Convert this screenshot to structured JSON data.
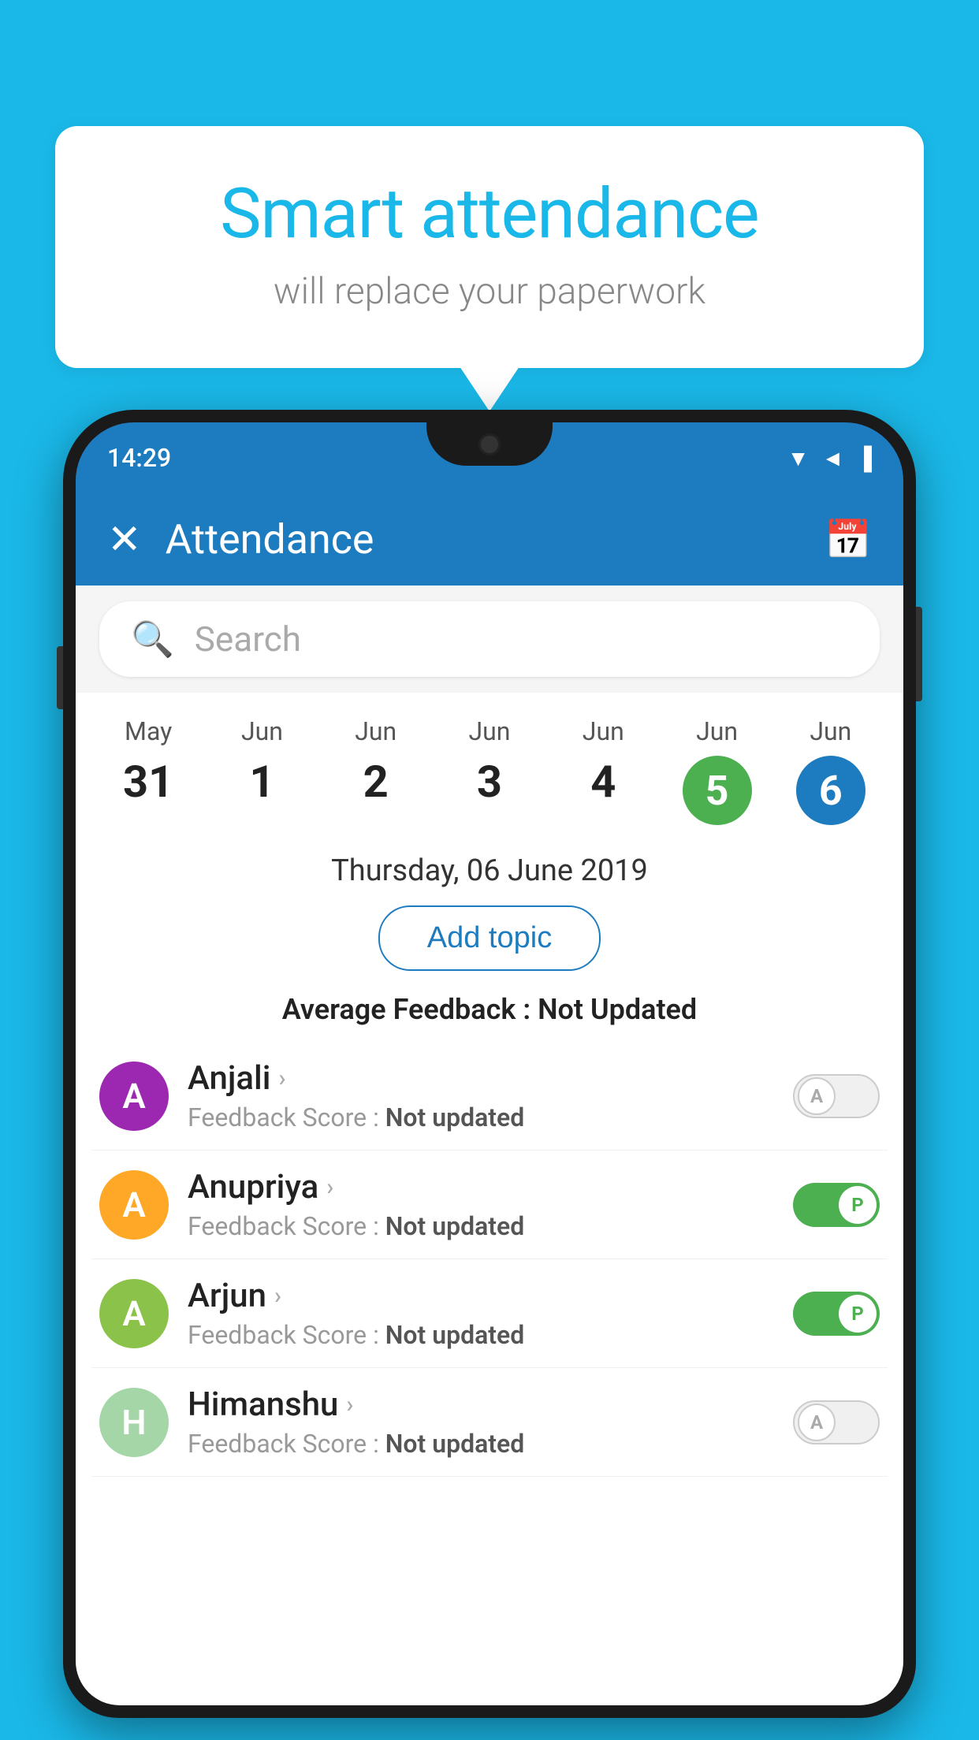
{
  "background_color": "#1ab8e8",
  "speech_bubble": {
    "title": "Smart attendance",
    "subtitle": "will replace your paperwork"
  },
  "status_bar": {
    "time": "14:29",
    "icons": "▼◄▐"
  },
  "app_header": {
    "title": "Attendance",
    "close_label": "✕",
    "calendar_icon": "📅"
  },
  "search": {
    "placeholder": "Search"
  },
  "calendar": {
    "days": [
      {
        "month": "May",
        "date": "31",
        "style": "normal"
      },
      {
        "month": "Jun",
        "date": "1",
        "style": "normal"
      },
      {
        "month": "Jun",
        "date": "2",
        "style": "normal"
      },
      {
        "month": "Jun",
        "date": "3",
        "style": "normal"
      },
      {
        "month": "Jun",
        "date": "4",
        "style": "normal"
      },
      {
        "month": "Jun",
        "date": "5",
        "style": "green"
      },
      {
        "month": "Jun",
        "date": "6",
        "style": "blue"
      }
    ]
  },
  "selected_date": "Thursday, 06 June 2019",
  "add_topic_label": "Add topic",
  "avg_feedback_label": "Average Feedback :",
  "avg_feedback_value": "Not Updated",
  "students": [
    {
      "name": "Anjali",
      "avatar_letter": "A",
      "avatar_color": "#9c27b0",
      "feedback_label": "Feedback Score :",
      "feedback_value": "Not updated",
      "attendance": "absent",
      "toggle_letter": "A"
    },
    {
      "name": "Anupriya",
      "avatar_letter": "A",
      "avatar_color": "#ffa726",
      "feedback_label": "Feedback Score :",
      "feedback_value": "Not updated",
      "attendance": "present",
      "toggle_letter": "P"
    },
    {
      "name": "Arjun",
      "avatar_letter": "A",
      "avatar_color": "#8bc34a",
      "feedback_label": "Feedback Score :",
      "feedback_value": "Not updated",
      "attendance": "present",
      "toggle_letter": "P"
    },
    {
      "name": "Himanshu",
      "avatar_letter": "H",
      "avatar_color": "#a5d6a7",
      "feedback_label": "Feedback Score :",
      "feedback_value": "Not updated",
      "attendance": "absent",
      "toggle_letter": "A"
    }
  ]
}
